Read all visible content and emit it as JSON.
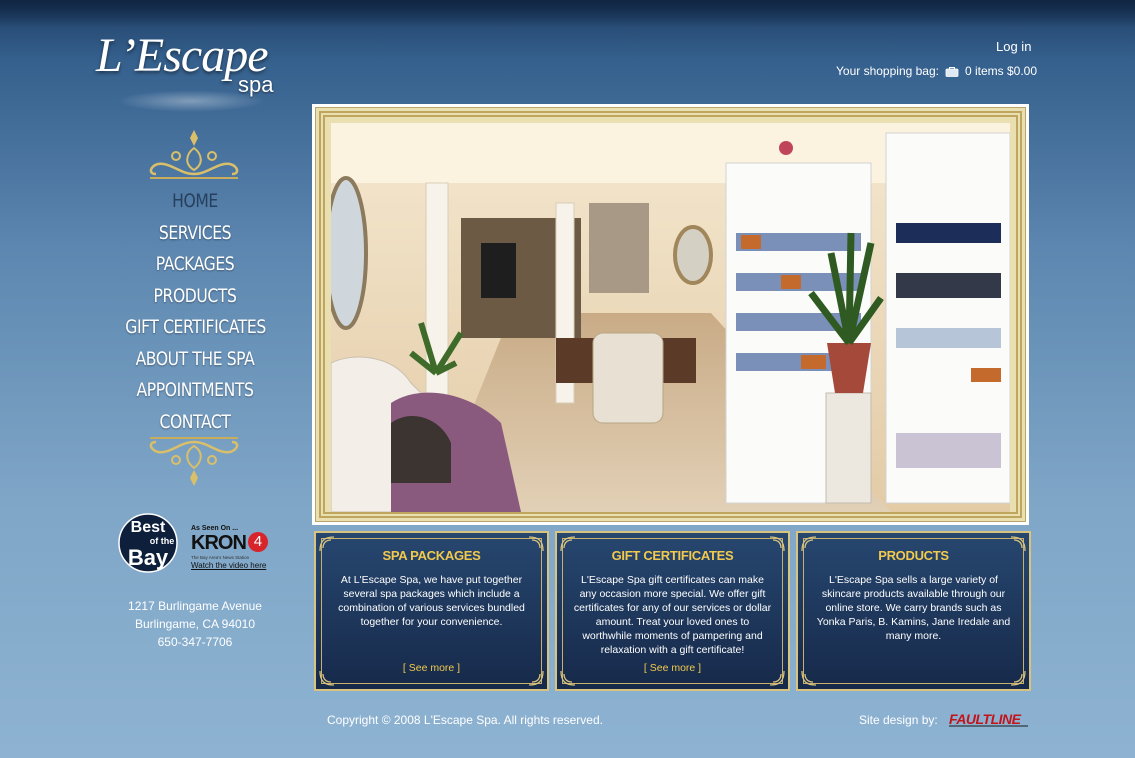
{
  "brand": {
    "logo_word": "L’Escape",
    "logo_sub": "spa"
  },
  "header": {
    "login_label": "Log in",
    "bag_label": "Your shopping bag:",
    "bag_summary": "0 items $0.00"
  },
  "nav": {
    "items": [
      {
        "label": "HOME"
      },
      {
        "label": "SERVICES"
      },
      {
        "label": "PACKAGES"
      },
      {
        "label": "PRODUCTS"
      },
      {
        "label": "GIFT CERTIFICATES"
      },
      {
        "label": "ABOUT THE SPA"
      },
      {
        "label": "APPOINTMENTS"
      },
      {
        "label": "CONTACT"
      }
    ]
  },
  "badges": {
    "best_line1": "Best",
    "best_line2": "of the",
    "best_line3": "Bay",
    "kron_top": "As Seen On ...",
    "kron_word": "KRON",
    "kron_num": "4",
    "kron_sub": "The Bay Area's News Station",
    "kron_watch": "Watch the video here"
  },
  "address": {
    "street": "1217 Burlingame Avenue",
    "city": "Burlingame, CA 94010",
    "phone": "650-347-7706"
  },
  "boxes": [
    {
      "title": "SPA PACKAGES",
      "text": "At L'Escape Spa, we have put together several spa packages which include a combination of various services bundled together for your convenience.",
      "more": "[ See more ]"
    },
    {
      "title": "GIFT CERTIFICATES",
      "text": "L'Escape Spa gift certificates can make any occasion more special. We offer gift certificates for any of our services or dollar amount. Treat your loved ones to worthwhile moments of pampering and relaxation with a gift certificate!",
      "more": "[ See more ]"
    },
    {
      "title": "PRODUCTS",
      "text": "L'Escape Spa sells a large variety of skincare products available through our online store. We carry brands such as Yonka Paris, B. Kamins, Jane Iredale and many more.",
      "more": ""
    }
  ],
  "footer": {
    "copyright": "Copyright © 2008 L'Escape Spa. All rights reserved.",
    "site_design_label": "Site design by:",
    "designer_logo": "FAULTLINE"
  },
  "colors": {
    "accent_gold": "#f2c94c",
    "nav_active": "#263f5c",
    "box_bg": "#1e3a5f"
  }
}
